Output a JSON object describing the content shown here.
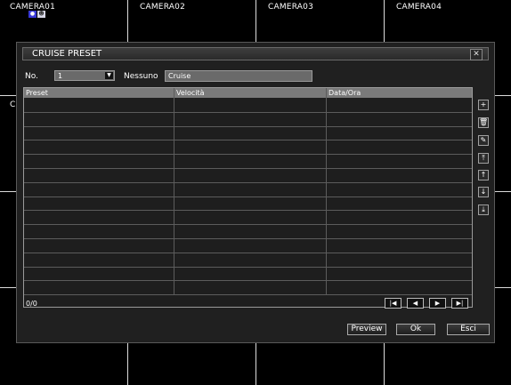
{
  "cameras": [
    {
      "label": "CAMERA01"
    },
    {
      "label": "CAMERA02"
    },
    {
      "label": "CAMERA03"
    },
    {
      "label": "CAMERA04"
    }
  ],
  "partial_label": "C",
  "status_icons": [
    "record-icon",
    "motion-icon"
  ],
  "dialog": {
    "title": "CRUISE PRESET",
    "close_icon": "close-icon",
    "no_label": "No.",
    "no_value": "1",
    "name_label": "Nessuno",
    "name_value": "Cruise",
    "table": {
      "columns": [
        "Preset",
        "Velocità",
        "Data/Ora"
      ],
      "rows": []
    },
    "side_buttons": [
      "add-icon",
      "delete-icon",
      "edit-icon",
      "move-top-icon",
      "move-up-icon",
      "move-down-icon",
      "move-bottom-icon"
    ],
    "side_glyphs": [
      "+",
      "🗑",
      "✎",
      "⤒",
      "↑",
      "↓",
      "⤓"
    ],
    "count": "0/0",
    "pager": [
      "first-page-icon",
      "prev-page-icon",
      "next-page-icon",
      "last-page-icon"
    ],
    "pager_glyphs": [
      "|◀",
      "◀",
      "▶",
      "▶|"
    ],
    "buttons": {
      "preview": "Preview",
      "ok": "Ok",
      "exit": "Esci"
    }
  }
}
